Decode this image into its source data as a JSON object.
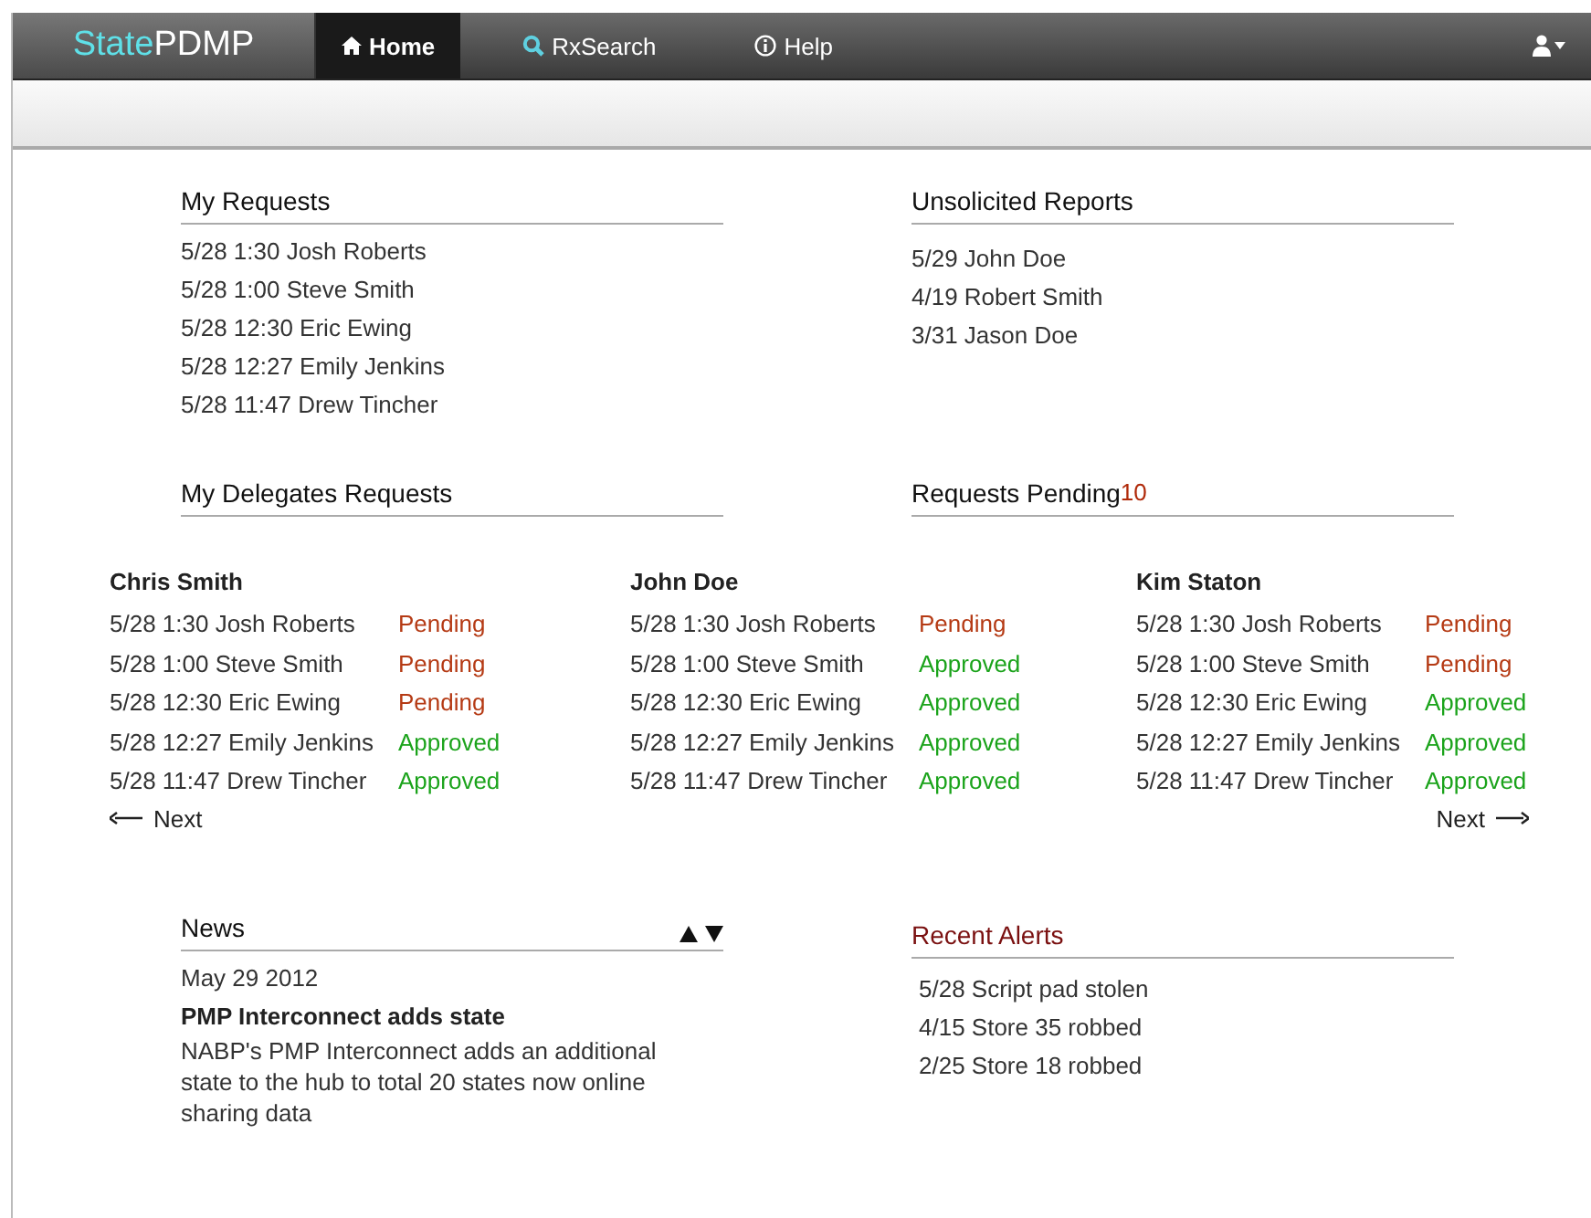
{
  "nav": {
    "logo_a": "State",
    "logo_b": "PDMP",
    "tabs": [
      {
        "label": "Home",
        "kind": "home",
        "selected": true
      },
      {
        "label": "RxSearch",
        "kind": "search",
        "selected": false
      },
      {
        "label": "Help",
        "kind": "info",
        "selected": false
      }
    ]
  },
  "my_requests": {
    "title": "My Requests",
    "items": [
      "5/28 1:30 Josh Roberts",
      "5/28 1:00 Steve Smith",
      "5/28 12:30 Eric Ewing",
      "5/28 12:27 Emily Jenkins",
      "5/28 11:47 Drew Tincher"
    ]
  },
  "unsolicited_reports": {
    "title": "Unsolicited Reports",
    "items": [
      "5/29 John Doe",
      "4/19 Robert Smith",
      "3/31 Jason Doe"
    ]
  },
  "delegates": {
    "title": "My Delegates Requests",
    "pending_title": "Requests Pending",
    "pending_count": "10",
    "prev": "Next",
    "next": "Next",
    "columns": [
      {
        "name": "Chris Smith",
        "rows": [
          {
            "text": "5/28 1:30 Josh Roberts",
            "status": "Pending",
            "kind": "pending"
          },
          {
            "text": "5/28 1:00 Steve Smith",
            "status": "Pending",
            "kind": "pending"
          },
          {
            "text": "5/28 12:30 Eric Ewing",
            "status": "Pending",
            "kind": "pending"
          },
          {
            "text": "5/28 12:27 Emily Jenkins",
            "status": "Approved",
            "kind": "approved"
          },
          {
            "text": "5/28 11:47 Drew Tincher",
            "status": "Approved",
            "kind": "approved"
          }
        ]
      },
      {
        "name": "John Doe",
        "rows": [
          {
            "text": "5/28 1:30 Josh Roberts",
            "status": "Pending",
            "kind": "pending"
          },
          {
            "text": "5/28 1:00 Steve Smith",
            "status": "Approved",
            "kind": "approved"
          },
          {
            "text": "5/28 12:30 Eric Ewing",
            "status": "Approved",
            "kind": "approved"
          },
          {
            "text": "5/28 12:27 Emily Jenkins",
            "status": "Approved",
            "kind": "approved"
          },
          {
            "text": "5/28 11:47 Drew Tincher",
            "status": "Approved",
            "kind": "approved"
          }
        ]
      },
      {
        "name": "Kim Staton",
        "rows": [
          {
            "text": "5/28 1:30 Josh Roberts",
            "status": "Pending",
            "kind": "pending"
          },
          {
            "text": "5/28 1:00 Steve Smith",
            "status": "Pending",
            "kind": "pending"
          },
          {
            "text": "5/28 12:30 Eric Ewing",
            "status": "Approved",
            "kind": "approved"
          },
          {
            "text": "5/28 12:27 Emily Jenkins",
            "status": "Approved",
            "kind": "approved"
          },
          {
            "text": "5/28 11:47 Drew Tincher",
            "status": "Approved",
            "kind": "approved"
          }
        ]
      }
    ]
  },
  "news": {
    "title": "News",
    "date": "May 29 2012",
    "headline": "PMP Interconnect adds state",
    "body": "NABP's PMP Interconnect adds an additional state to the hub to total 20 states now online sharing data"
  },
  "recent_alerts": {
    "title": "Recent Alerts",
    "items": [
      "5/28 Script pad stolen",
      "4/15 Store 35 robbed",
      "2/25 Store 18 robbed"
    ]
  }
}
